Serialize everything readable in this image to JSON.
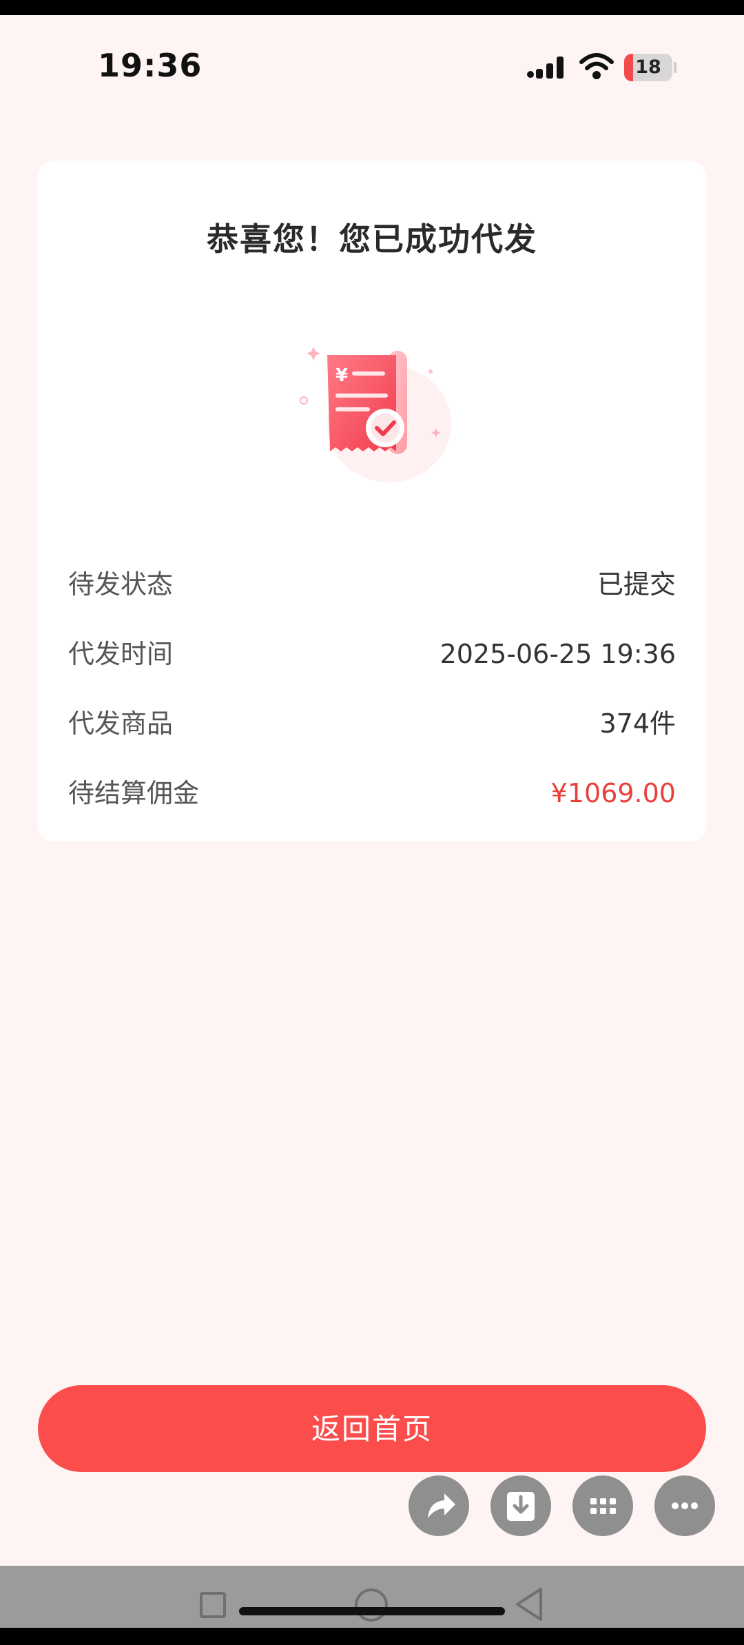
{
  "status_bar": {
    "time": "19:36",
    "battery_level": "18",
    "battery_fraction": 0.18,
    "icons": [
      "signal-icon",
      "wifi-icon",
      "battery-icon"
    ]
  },
  "card": {
    "title": "恭喜您！您已成功代发",
    "illustration": "receipt-success-icon",
    "rows": [
      {
        "label": "待发状态",
        "value": "已提交"
      },
      {
        "label": "代发时间",
        "value": "2025-06-25 19:36"
      },
      {
        "label": "代发商品",
        "value": "374件"
      },
      {
        "label": "待结算佣金",
        "value": "¥1069.00"
      }
    ]
  },
  "actions": {
    "home_button_label": "返回首页"
  },
  "floating_actions": [
    "share-icon",
    "download-icon",
    "grid-menu-icon",
    "more-icon"
  ],
  "colors": {
    "accent": "#fb4d4b",
    "amount": "#e8413c",
    "background": "#fff4f4"
  }
}
